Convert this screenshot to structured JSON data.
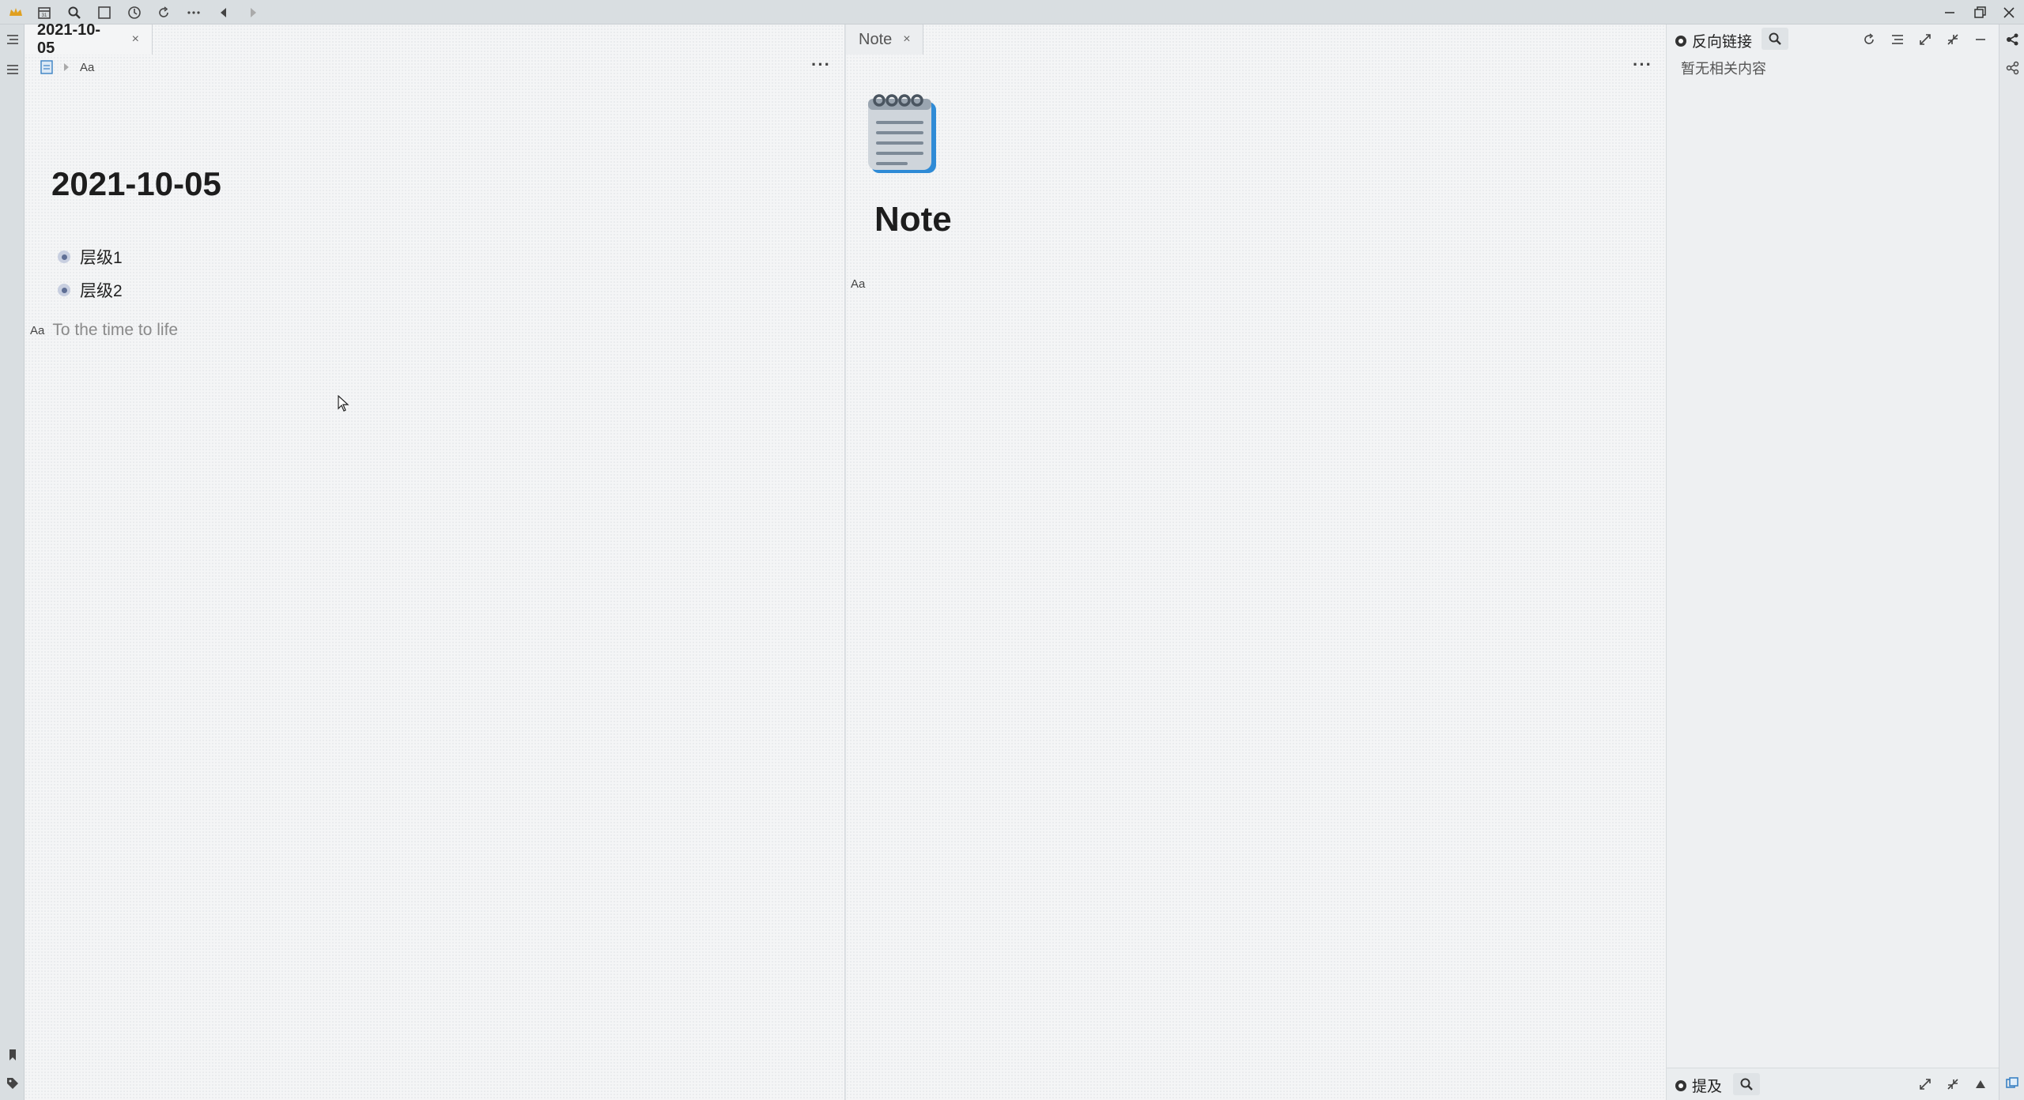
{
  "titlebar": {
    "icons": [
      "logo-icon",
      "calendar-icon",
      "search-icon",
      "square-icon",
      "clock-icon",
      "sync-icon",
      "more-icon",
      "back-icon",
      "forward-icon"
    ],
    "window_controls": [
      "minimize-icon",
      "restore-icon",
      "close-icon"
    ]
  },
  "left_pane": {
    "tab_label": "2021-10-05",
    "tab_close": "×",
    "breadcrumb_aa": "Aa",
    "title": "2021-10-05",
    "items": [
      {
        "label": "层级1"
      },
      {
        "label": "层级2"
      }
    ],
    "placeholder_aa": "Aa",
    "placeholder": "To the time to life",
    "more": "···"
  },
  "mid_pane": {
    "tab_label": "Note",
    "tab_close": "×",
    "title": "Note",
    "attr_aa": "Aa",
    "more": "···"
  },
  "backlinks": {
    "label": "反向链接",
    "empty_text": "暂无相关内容"
  },
  "mentions": {
    "label": "提及"
  },
  "colors": {
    "accent": "#3b82c4",
    "bg": "#f4f5f6",
    "chrome": "#d9dee1"
  }
}
